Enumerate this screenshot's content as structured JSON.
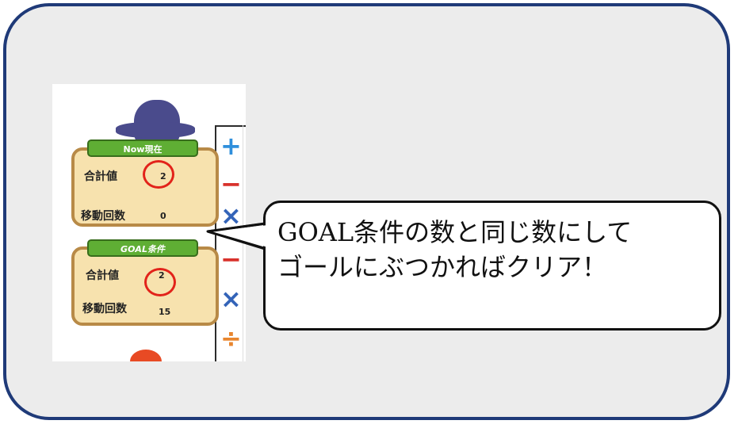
{
  "now_panel": {
    "tab_label": "Now現在",
    "sum_label": "合計値",
    "sum_value": "2",
    "moves_label": "移動回数",
    "moves_value": "0"
  },
  "goal_panel": {
    "tab_label": "GOAL条件",
    "sum_label": "合計値",
    "sum_value": "2",
    "moves_label": "移動回数",
    "moves_value": "15"
  },
  "operators": {
    "plus": "+",
    "minus": "−",
    "times": "×",
    "divide": "÷"
  },
  "callout": {
    "line1": "GOAL条件の数と同じ数にして",
    "line2": "ゴールにぶつかればクリア！"
  },
  "colors": {
    "frame_border": "#1f3a78",
    "frame_bg": "#ececec",
    "panel_bg": "#f7e2ae",
    "panel_border": "#b88a47",
    "tab_green": "#5fae34",
    "highlight_red": "#e2231a"
  }
}
